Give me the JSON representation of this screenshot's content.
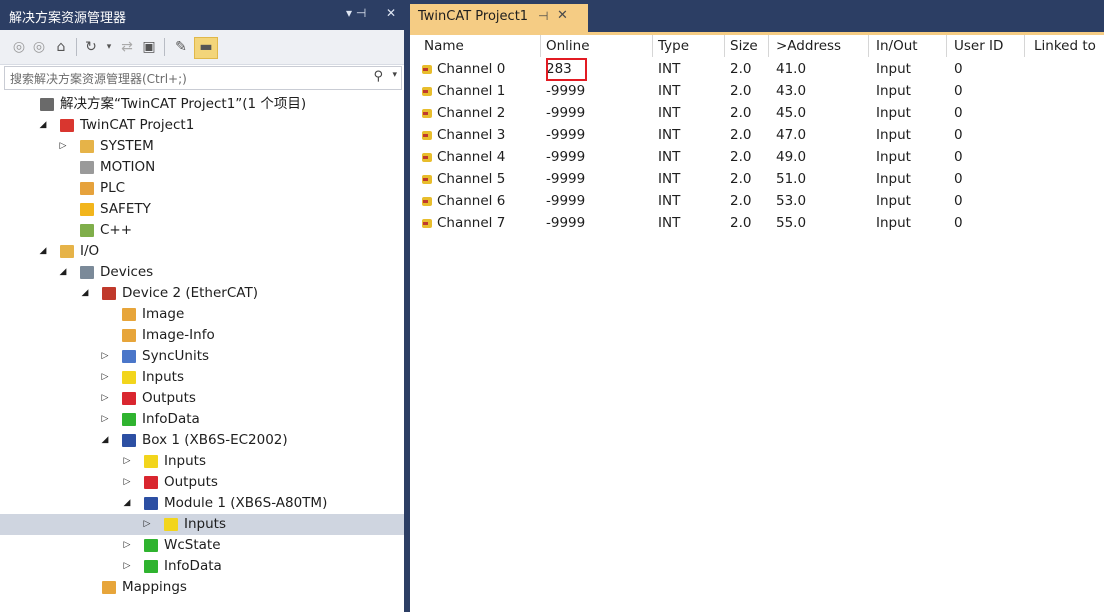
{
  "left_panel": {
    "title": "解决方案资源管理器",
    "pin_glyph": "▾ ⊣",
    "close_glyph": "✕",
    "search_placeholder": "搜索解决方案资源管理器(Ctrl+;)"
  },
  "tree": [
    {
      "label": "解决方案“TwinCAT Project1”(1 个项目)",
      "depth": 0,
      "expander": "",
      "icon": "solution-icon",
      "color": "#6a6a6a"
    },
    {
      "label": "TwinCAT Project1",
      "depth": 1,
      "expander": "◢",
      "icon": "project-icon",
      "color": "#d9362f"
    },
    {
      "label": "SYSTEM",
      "depth": 2,
      "expander": "▷",
      "icon": "system-icon",
      "color": "#e6b348"
    },
    {
      "label": "MOTION",
      "depth": 2,
      "expander": "",
      "icon": "motion-icon",
      "color": "#9a9a9a"
    },
    {
      "label": "PLC",
      "depth": 2,
      "expander": "",
      "icon": "plc-icon",
      "color": "#e6a23c"
    },
    {
      "label": "SAFETY",
      "depth": 2,
      "expander": "",
      "icon": "safety-icon",
      "color": "#f2b51c"
    },
    {
      "label": "C++",
      "depth": 2,
      "expander": "",
      "icon": "cpp-icon",
      "color": "#7fae4a"
    },
    {
      "label": "I/O",
      "depth": 1,
      "expander": "◢",
      "icon": "io-icon",
      "color": "#e6b348"
    },
    {
      "label": "Devices",
      "depth": 2,
      "expander": "◢",
      "icon": "devices-icon",
      "color": "#7b8a99"
    },
    {
      "label": "Device 2 (EtherCAT)",
      "depth": 3,
      "expander": "◢",
      "icon": "ethercat-icon",
      "color": "#c0392b"
    },
    {
      "label": "Image",
      "depth": 4,
      "expander": "",
      "icon": "image-icon",
      "color": "#e7a53a"
    },
    {
      "label": "Image-Info",
      "depth": 4,
      "expander": "",
      "icon": "image-info-icon",
      "color": "#e7a53a"
    },
    {
      "label": "SyncUnits",
      "depth": 4,
      "expander": "▷",
      "icon": "syncunits-icon",
      "color": "#4a76c9"
    },
    {
      "label": "Inputs",
      "depth": 4,
      "expander": "▷",
      "icon": "inputs-icon",
      "color": "#f2d51c"
    },
    {
      "label": "Outputs",
      "depth": 4,
      "expander": "▷",
      "icon": "outputs-icon",
      "color": "#d9262f"
    },
    {
      "label": "InfoData",
      "depth": 4,
      "expander": "▷",
      "icon": "infodata-icon",
      "color": "#2fb32f"
    },
    {
      "label": "Box 1 (XB6S-EC2002)",
      "depth": 4,
      "expander": "◢",
      "icon": "box-icon",
      "color": "#2c4fa3"
    },
    {
      "label": "Inputs",
      "depth": 5,
      "expander": "▷",
      "icon": "inputs-icon",
      "color": "#f2d51c"
    },
    {
      "label": "Outputs",
      "depth": 5,
      "expander": "▷",
      "icon": "outputs-icon",
      "color": "#d9262f"
    },
    {
      "label": "Module 1 (XB6S-A80TM)",
      "depth": 5,
      "expander": "◢",
      "icon": "module-icon",
      "color": "#2c4fa3"
    },
    {
      "label": "Inputs",
      "depth": 6,
      "expander": "▷",
      "icon": "inputs-icon",
      "color": "#f2d51c",
      "selected": true
    },
    {
      "label": "WcState",
      "depth": 5,
      "expander": "▷",
      "icon": "wcstate-icon",
      "color": "#2fb32f"
    },
    {
      "label": "InfoData",
      "depth": 5,
      "expander": "▷",
      "icon": "infodata-icon",
      "color": "#2fb32f"
    },
    {
      "label": "Mappings",
      "depth": 3,
      "expander": "",
      "icon": "mappings-icon",
      "color": "#e7a53a"
    }
  ],
  "tab": {
    "label": "TwinCAT Project1",
    "pin_glyph": "⊣",
    "close_glyph": "✕"
  },
  "table": {
    "headers": [
      "Name",
      "Online",
      "Type",
      "Size",
      ">Address",
      "In/Out",
      "User ID",
      "Linked to"
    ],
    "rows": [
      [
        "Channel 0",
        "283",
        "INT",
        "2.0",
        "41.0",
        "Input",
        "0",
        ""
      ],
      [
        "Channel 1",
        "-9999",
        "INT",
        "2.0",
        "43.0",
        "Input",
        "0",
        ""
      ],
      [
        "Channel 2",
        "-9999",
        "INT",
        "2.0",
        "45.0",
        "Input",
        "0",
        ""
      ],
      [
        "Channel 3",
        "-9999",
        "INT",
        "2.0",
        "47.0",
        "Input",
        "0",
        ""
      ],
      [
        "Channel 4",
        "-9999",
        "INT",
        "2.0",
        "49.0",
        "Input",
        "0",
        ""
      ],
      [
        "Channel 5",
        "-9999",
        "INT",
        "2.0",
        "51.0",
        "Input",
        "0",
        ""
      ],
      [
        "Channel 6",
        "-9999",
        "INT",
        "2.0",
        "53.0",
        "Input",
        "0",
        ""
      ],
      [
        "Channel 7",
        "-9999",
        "INT",
        "2.0",
        "55.0",
        "Input",
        "0",
        ""
      ]
    ]
  },
  "colors": {
    "title_bg": "#2c3e64",
    "tab_active": "#f5cc84",
    "highlight_box": "#e21b23",
    "selected_row": "#cfd5e0"
  }
}
